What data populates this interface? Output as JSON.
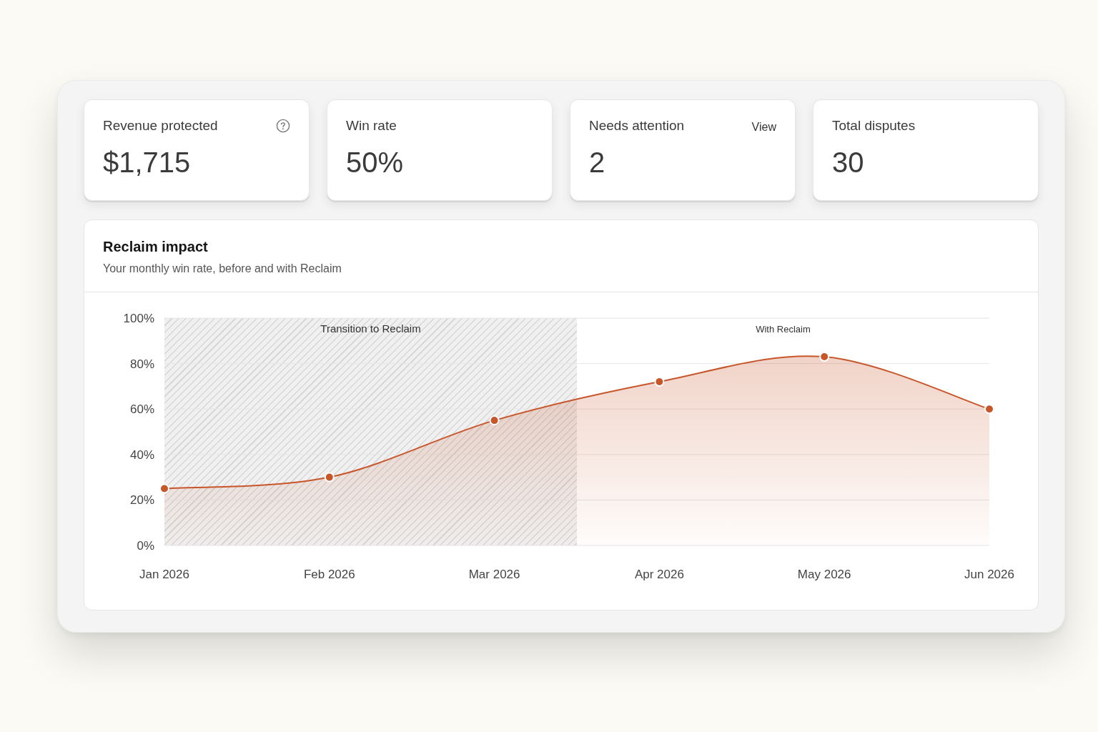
{
  "stats": [
    {
      "kind": "help",
      "label": "Revenue protected",
      "value": "$1,715"
    },
    {
      "kind": "plain",
      "label": "Win rate",
      "value": "50%"
    },
    {
      "kind": "link",
      "label": "Needs attention",
      "action": "View",
      "value": "2"
    },
    {
      "kind": "plain",
      "label": "Total disputes",
      "value": "30"
    }
  ],
  "impact": {
    "title": "Reclaim impact",
    "subtitle": "Your monthly win rate, before and with Reclaim",
    "chart_data": {
      "type": "area",
      "categories": [
        "Jan 2026",
        "Feb 2026",
        "Mar 2026",
        "Apr 2026",
        "May 2026",
        "Jun 2026"
      ],
      "series": [
        {
          "color": "#c8562b",
          "values": [
            25,
            30,
            55,
            72,
            83,
            60
          ]
        }
      ],
      "ylim": [
        0,
        100
      ],
      "yticks": [
        {
          "value": 0,
          "label": "0%"
        },
        {
          "value": 20,
          "label": "20%"
        },
        {
          "value": 40,
          "label": "40%"
        },
        {
          "value": 60,
          "label": "60%"
        },
        {
          "value": 80,
          "label": "80%"
        },
        {
          "value": 100,
          "label": "100%"
        }
      ],
      "grid": true,
      "annotations": [
        "Transition to Reclaim",
        "With Reclaim"
      ]
    }
  }
}
